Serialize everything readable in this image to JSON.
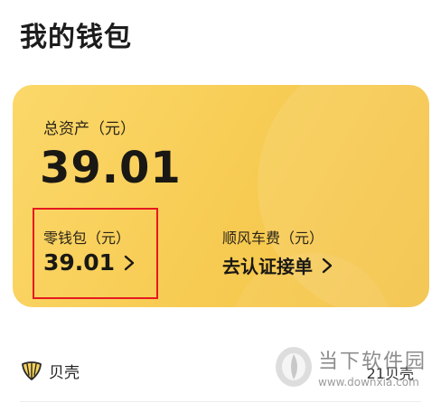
{
  "page": {
    "title": "我的钱包"
  },
  "card": {
    "total_label": "总资产（元）",
    "total_value": "39.01",
    "change_label": "零钱包（元）",
    "change_value": "39.01",
    "ride_label": "顺风车费（元）",
    "ride_action": "去认证接单",
    "highlight_color": "#e5191f"
  },
  "shell": {
    "label": "贝壳",
    "value": "21贝壳",
    "icon": "shell-icon"
  },
  "watermark": {
    "name": "当下软件园",
    "url": "www.downxia.com"
  },
  "colors": {
    "card_gradient_start": "#fbd86a",
    "card_gradient_end": "#f3c142"
  }
}
